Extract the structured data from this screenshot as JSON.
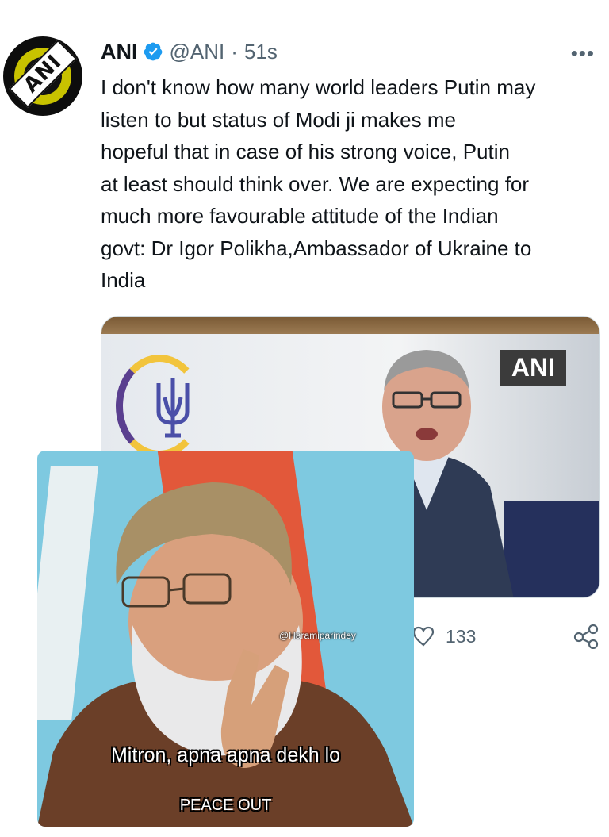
{
  "tweet": {
    "author": {
      "display_name": "ANI",
      "handle": "@ANI",
      "verified": true,
      "avatar_logo": "ANI"
    },
    "separator": "·",
    "timestamp": "51s",
    "more_label": "•••",
    "text_lines": [
      "I don't know how many world leaders Putin may",
      "listen to but status of Modi ji makes me",
      "hopeful that in case of his strong voice, Putin",
      "at least should think over. We are expecting for",
      "much more favourable attitude of the Indian",
      "govt: Dr Igor Polikha,Ambassador of Ukraine to",
      "India"
    ],
    "media": {
      "badge": "ANI"
    },
    "actions": {
      "like_icon": "heart-icon",
      "like_count": "133",
      "share_icon": "share-icon"
    }
  },
  "meme": {
    "watermark": "@Haramiparindey",
    "caption": "Mitron, apna apna dekh lo",
    "subcaption": "PEACE OUT"
  },
  "colors": {
    "verified": "#1d9bf0",
    "secondary_text": "#536471",
    "primary_text": "#0f1419"
  }
}
